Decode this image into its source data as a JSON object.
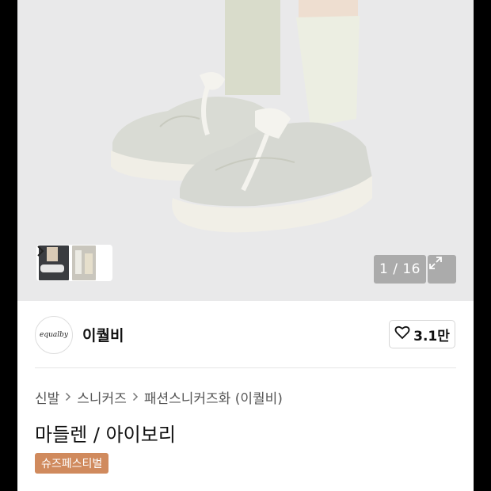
{
  "gallery": {
    "counter": "1 / 16",
    "more_icon": "chevron-right-icon",
    "expand_icon": "expand-icon"
  },
  "brand": {
    "logo_text": "equalby",
    "name": "이퀄비",
    "likes": "3.1만",
    "like_icon": "heart-icon"
  },
  "breadcrumb": {
    "items": [
      "신발",
      "스니커즈",
      "패션스니커즈화 (이퀄비)"
    ],
    "separator_icon": "chevron-right-icon"
  },
  "product": {
    "title": "마들렌 / 아이보리",
    "tag": "슈즈페스티벌"
  },
  "colors": {
    "tag_bg": "#d08a5d",
    "hero_bg": "#e9e9ea"
  }
}
